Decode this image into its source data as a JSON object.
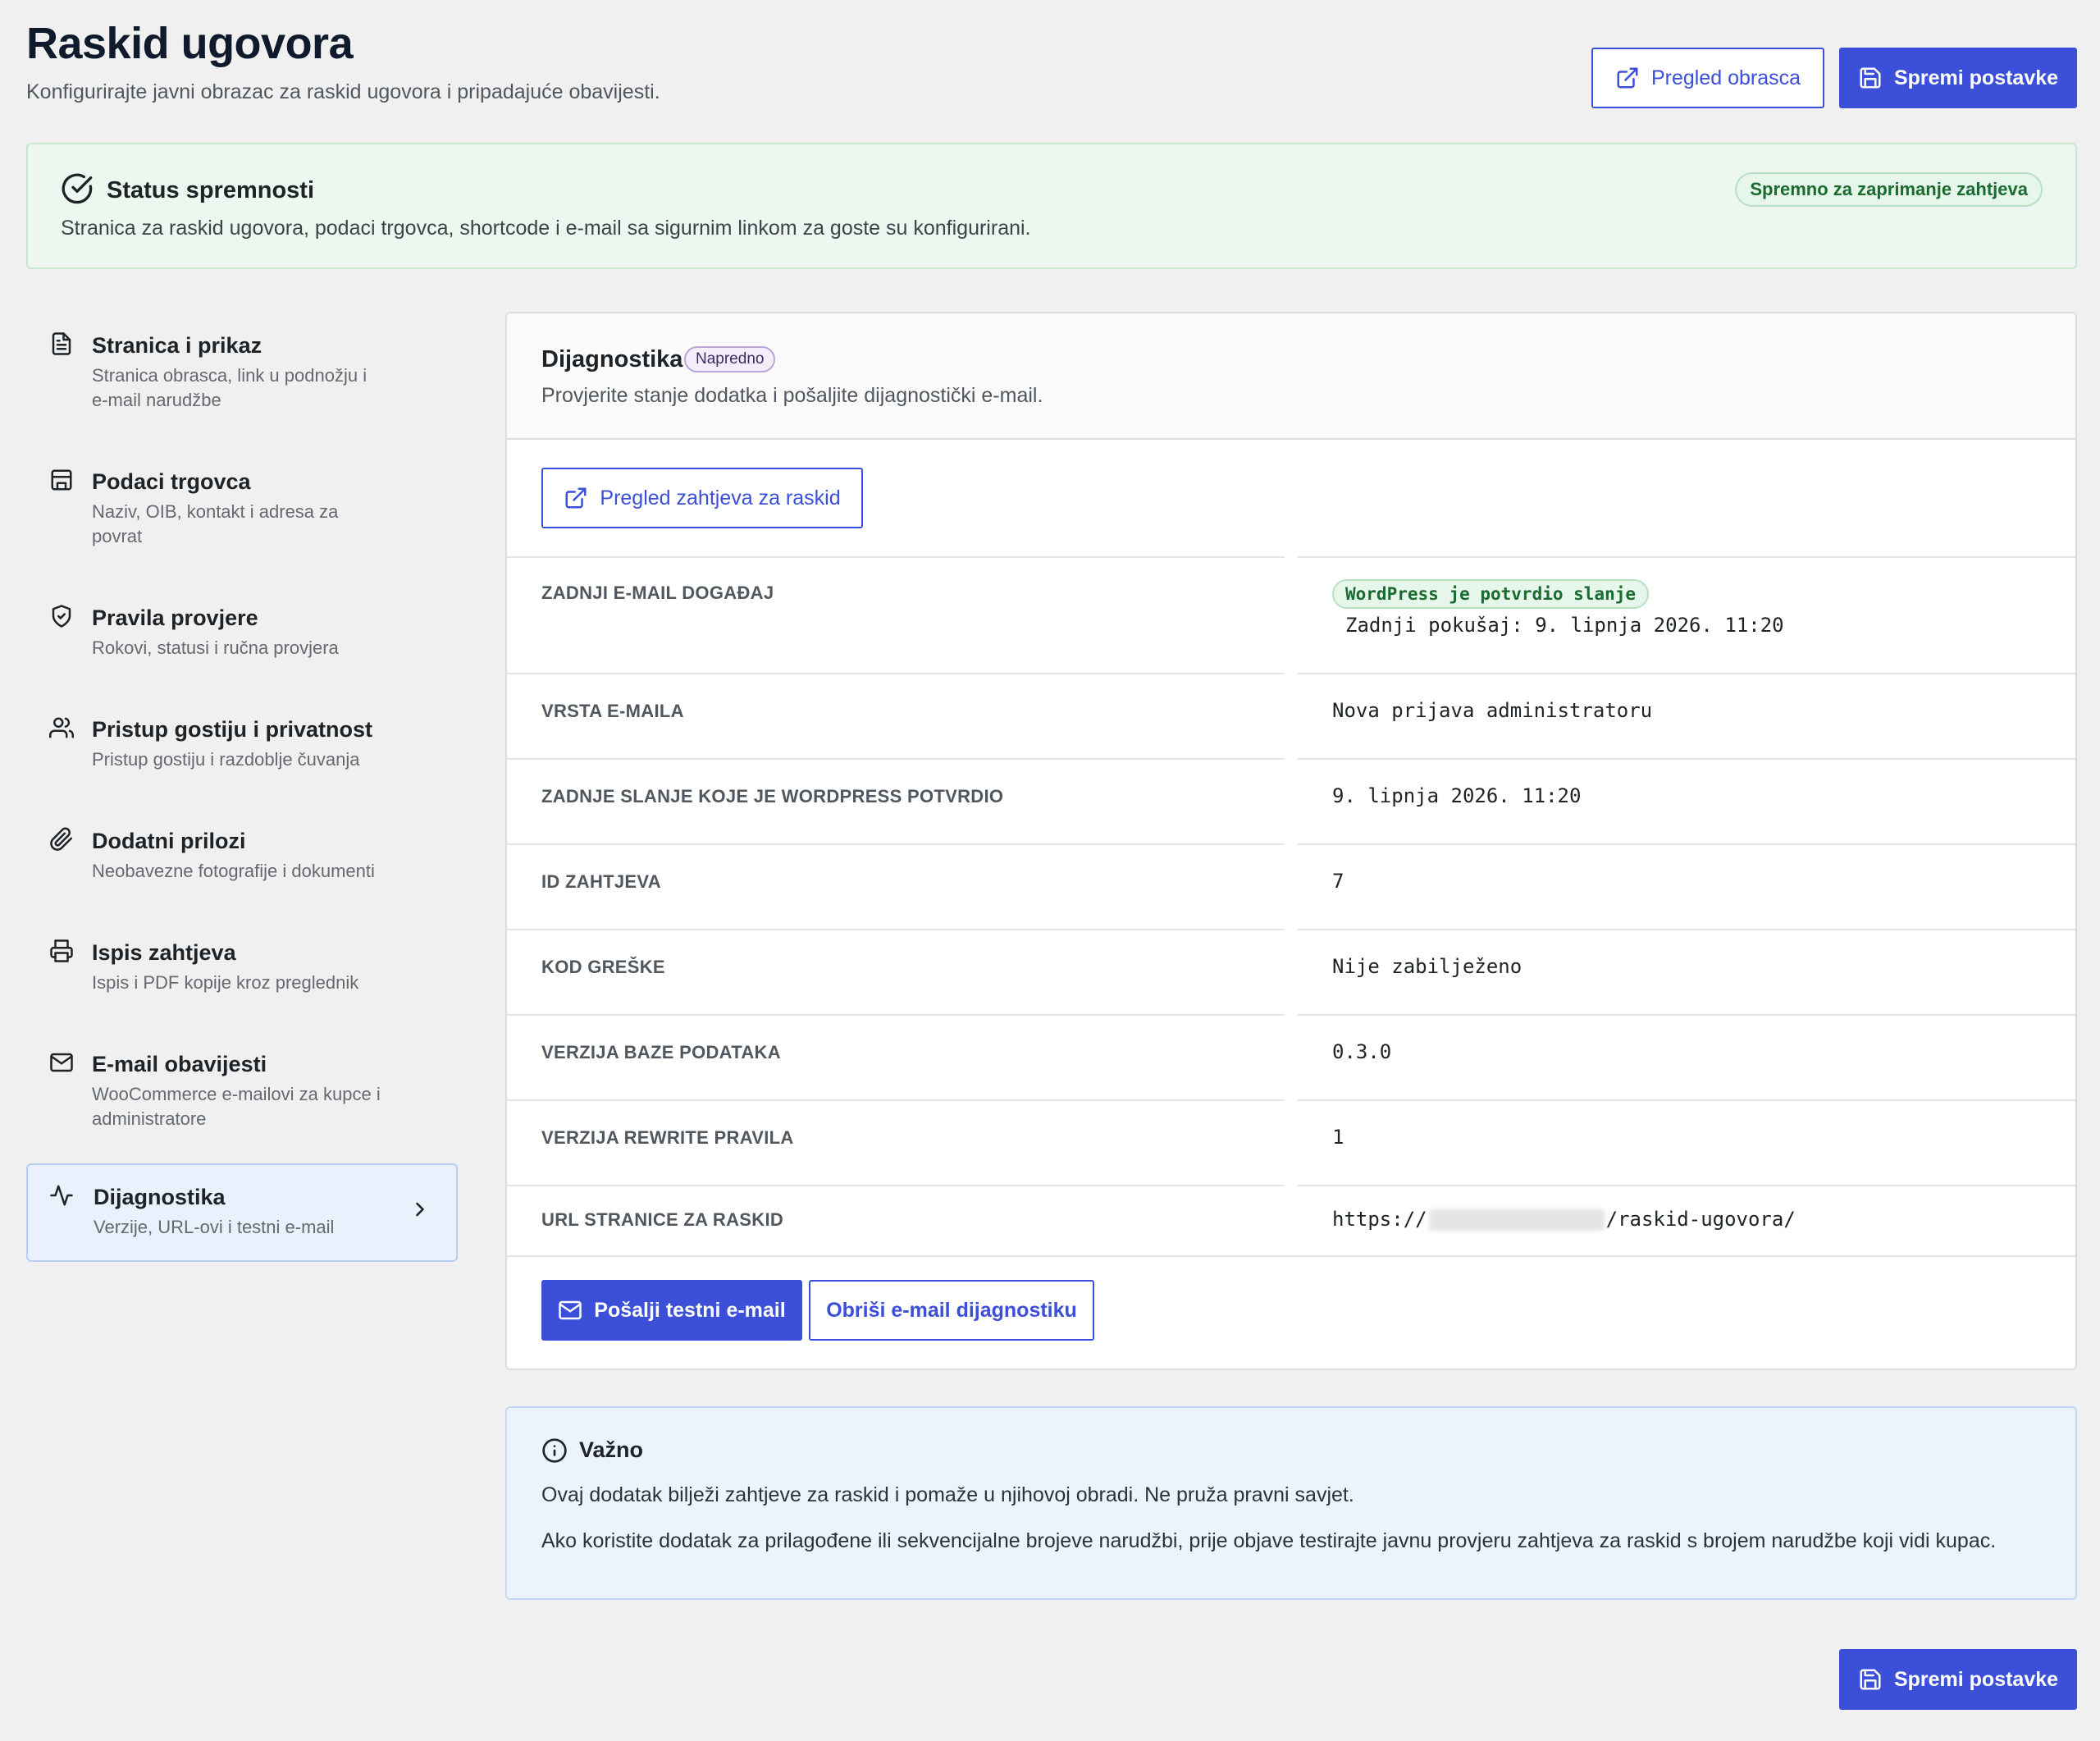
{
  "header": {
    "title": "Raskid ugovora",
    "subtitle": "Konfigurirajte javni obrazac za raskid ugovora i pripadajuće obavijesti.",
    "preview_button": "Pregled obrasca",
    "save_button": "Spremi postavke"
  },
  "status": {
    "title": "Status spremnosti",
    "text": "Stranica za raskid ugovora, podaci trgovca, shortcode i e-mail sa sigurnim linkom za goste su konfigurirani.",
    "badge": "Spremno za zaprimanje zahtjeva"
  },
  "sidebar": {
    "items": [
      {
        "label": "Stranica i prikaz",
        "desc": "Stranica obrasca, link u podnožju i e-mail narudžbe",
        "icon": "document-icon"
      },
      {
        "label": "Podaci trgovca",
        "desc": "Naziv, OIB, kontakt i adresa za povrat",
        "icon": "store-icon"
      },
      {
        "label": "Pravila provjere",
        "desc": "Rokovi, statusi i ručna provjera",
        "icon": "shield-icon"
      },
      {
        "label": "Pristup gostiju i privatnost",
        "desc": "Pristup gostiju i razdoblje čuvanja",
        "icon": "users-icon"
      },
      {
        "label": "Dodatni prilozi",
        "desc": "Neobavezne fotografije i dokumenti",
        "icon": "paperclip-icon"
      },
      {
        "label": "Ispis zahtjeva",
        "desc": "Ispis i PDF kopije kroz preglednik",
        "icon": "printer-icon"
      },
      {
        "label": "E-mail obavijesti",
        "desc": "WooCommerce e-mailovi za kupce i administratore",
        "icon": "mail-icon"
      },
      {
        "label": "Dijagnostika",
        "desc": "Verzije, URL-ovi i testni e-mail",
        "icon": "activity-icon",
        "active": true
      }
    ]
  },
  "diagnostics": {
    "title": "Dijagnostika",
    "badge": "Napredno",
    "subtitle": "Provjerite stanje dodatka i pošaljite dijagnostički e-mail.",
    "review_button": "Pregled zahtjeva za raskid",
    "rows": [
      {
        "key": "ZADNJI E-MAIL DOGAĐAJ",
        "pill": "WordPress je potvrdio slanje",
        "value": "Zadnji pokušaj: 9. lipnja 2026. 11:20"
      },
      {
        "key": "VRSTA E-MAILA",
        "value": "Nova prijava administratoru"
      },
      {
        "key": "ZADNJE SLANJE KOJE JE WORDPRESS POTVRDIO",
        "value": "9. lipnja 2026. 11:20"
      },
      {
        "key": "ID ZAHTJEVA",
        "value": "7"
      },
      {
        "key": "KOD GREŠKE",
        "value": "Nije zabilježeno"
      },
      {
        "key": "VERZIJA BAZE PODATAKA",
        "value": "0.3.0"
      },
      {
        "key": "VERZIJA REWRITE PRAVILA",
        "value": "1"
      },
      {
        "key": "URL STRANICE ZA RASKID",
        "url_prefix": "https://",
        "url_suffix": "/raskid-ugovora/"
      }
    ],
    "send_test_button": "Pošalji testni e-mail",
    "clear_button": "Obriši e-mail dijagnostiku"
  },
  "important": {
    "title": "Važno",
    "p1": "Ovaj dodatak bilježi zahtjeve za raskid i pomaže u njihovoj obradi. Ne pruža pravni savjet.",
    "p2": "Ako koristite dodatak za prilagođene ili sekvencijalne brojeve narudžbi, prije objave testirajte javnu provjeru zahtjeva za raskid s brojem narudžbe koji vidi kupac."
  },
  "footer": {
    "save_button": "Spremi postavke"
  },
  "colors": {
    "accent": "#3b4fd8",
    "success": "#1a6b2f",
    "background": "#f0f0f1"
  }
}
